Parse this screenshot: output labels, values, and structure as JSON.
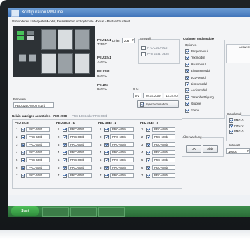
{
  "window": {
    "title": "Konfiguration PM-Line"
  },
  "header": {
    "text": "Vorhandenes Untergestell/Modul, Relais/Karten und optionale Module - Bestand/Zustand"
  },
  "modules": [
    {
      "name": "PEU-1241",
      "type": "7xPRC"
    },
    {
      "name": "PEU-2241",
      "type": "7xPRC"
    },
    {
      "name": "PEU-208",
      "type": "8xPRC"
    },
    {
      "name": "PE-19S",
      "type": "8xPRC"
    }
  ],
  "lines": {
    "label": "Linien",
    "value": "206"
  },
  "auswahl": {
    "label": "Auswahl",
    "items": [
      "PTC-2240-M16",
      "PTC-2241-M108"
    ]
  },
  "firmware": {
    "label": "Firmware",
    "value": "PEU-2240-M-08 8 17b"
  },
  "utc": {
    "label": "UTc",
    "values": [
      "DV",
      "20.03.2009",
      "13:34:40"
    ],
    "sync_label": "Synchronisation"
  },
  "relais": {
    "title": "Relais anzeigen auswählen - PEU-2008",
    "subtitle": "PRC-1084 oder PRC-608b",
    "columns": [
      {
        "header": "PEU-2240",
        "rows": [
          "1",
          "2",
          "3",
          "4",
          "5",
          "6",
          "7"
        ]
      },
      {
        "header": "PEU-2040 - 1",
        "rows": [
          "1",
          "2",
          "3",
          "4",
          "5",
          "6",
          "7"
        ]
      },
      {
        "header": "PEU-2040 - 2",
        "rows": [
          "1",
          "2",
          "3",
          "4",
          "5",
          "6",
          "7"
        ]
      },
      {
        "header": "PEU-2040 - 3",
        "rows": [
          "1",
          "2",
          "3",
          "4",
          "5",
          "6",
          "7"
        ]
      }
    ],
    "cell_value": "PRC-608b"
  },
  "options": {
    "group_title": "Optionen und Module",
    "sub_title": "Optionen",
    "items": [
      "Bürgermodul",
      "Textmodul",
      "Hausmodul",
      "Eingangmodul",
      "LCD-Modul",
      "Listenmodul",
      "Audiomodul",
      "Tastenbetätigung",
      "Gruppe",
      "Szene"
    ]
  },
  "auswertung": {
    "label": "Auswert"
  },
  "hauskanal": {
    "label": "Hauskanal",
    "items": [
      "PMC-0",
      "PMC-0",
      "PMC-0"
    ]
  },
  "uberwachung": {
    "label": "Überwachung",
    "ok_label": "OK",
    "cancel_label": "Abbr"
  },
  "intervall": {
    "label": "Intervall",
    "value": "1000s"
  },
  "taskbar": {
    "start_label": "Start"
  },
  "colors": {
    "titlebar": "#3e72b8",
    "taskbar": "#2b6d38",
    "accent_green": "#47c15a"
  }
}
